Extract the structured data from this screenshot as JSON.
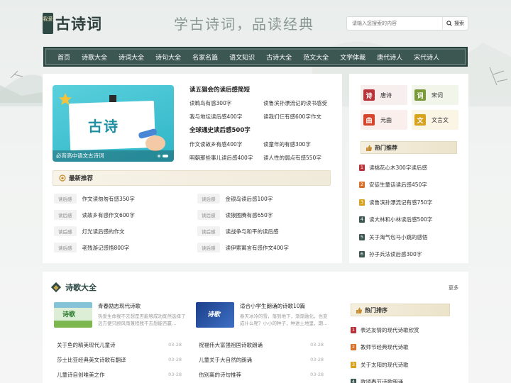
{
  "header": {
    "logo_seal": "我爱",
    "logo_text": "古诗词",
    "slogan": "学古诗词，品读经典",
    "search": {
      "placeholder": "请输入您搜索的内容",
      "button_label": "搜索"
    }
  },
  "nav": {
    "items": [
      "首页",
      "诗歌大全",
      "诗词大全",
      "诗句大全",
      "名家名篇",
      "语文知识",
      "古诗大全",
      "范文大全",
      "文学体裁",
      "唐代诗人",
      "宋代诗人"
    ]
  },
  "banner": {
    "title": "古诗",
    "caption": "必背高中语文古诗词"
  },
  "notes": {
    "heading1": "读五猖会的读后感简短",
    "list1": [
      "读鹈鸟有感300字",
      "读鲁滨孙漂流记的读书感受",
      "我与地坛读后感400字",
      "读我们仨有感600字作文"
    ],
    "heading2": "全球通史读后感500字",
    "list2": [
      "作文读故乡有感400字",
      "读童年的有感300字",
      "明朝那些事儿读后感400字",
      "读人性的弱点有感550字"
    ]
  },
  "recommend": {
    "title": "最新推荐",
    "items": [
      {
        "tag": "读后感",
        "text": "作文读匆匆有感350字"
      },
      {
        "tag": "读后感",
        "text": "金银岛读后感100字"
      },
      {
        "tag": "读后感",
        "text": "读故乡有感作文600字"
      },
      {
        "tag": "读后感",
        "text": "读狼图腾有感650字"
      },
      {
        "tag": "读后感",
        "text": "灯光读后感的作文"
      },
      {
        "tag": "读后感",
        "text": "读战争与和平的读后感"
      },
      {
        "tag": "读后感",
        "text": "老残游记感悟800字"
      },
      {
        "tag": "读后感",
        "text": "读伊索寓言有感作文400字"
      }
    ]
  },
  "categories": [
    {
      "icon": "诗",
      "label": "唐诗",
      "color": "#b8343a",
      "bg": "#f7eeee"
    },
    {
      "icon": "词",
      "label": "宋词",
      "color": "#7a9a3a",
      "bg": "#f1f5ea"
    },
    {
      "icon": "曲",
      "label": "元曲",
      "color": "#d4452b",
      "bg": "#faefec"
    },
    {
      "icon": "文",
      "label": "文言文",
      "color": "#d8a21f",
      "bg": "#fbf5e6"
    }
  ],
  "hot_recommend": {
    "title": "热门推荐",
    "items": [
      "读桃花心木300字读后感",
      "安徒生童话读后感450字",
      "读鲁滨孙漂流记有感750字",
      "读大林和小林读后感500字",
      "关于淘气包马小跳的感悟",
      "孙子兵法读后感300字"
    ]
  },
  "poetry": {
    "title": "诗歌大全",
    "more": "更多",
    "cards": [
      {
        "title": "青春励志现代诗歌",
        "desc": "热爱生命我不去想是否能够成功既然选择了远方便只顾风雨兼程我不去想能否赢…",
        "thumb_text": "诗歌"
      },
      {
        "title": "适合小学生朗诵的诗歌10篇",
        "desc": "春天冰冷的雪，落到地下，渐渐融化，也变成什么呢？小小的种子，种进土地里，期…",
        "thumb_text": "诗歌"
      }
    ],
    "col1": [
      {
        "text": "关于鱼的精美现代儿童诗",
        "date": "03-28"
      },
      {
        "text": "莎士比亚经典英文诗歌有翻译",
        "date": "03-28"
      },
      {
        "text": "儿童诗自创唯美之作",
        "date": "03-28"
      }
    ],
    "col2": [
      {
        "text": "祝福伟大富强祖国诗歌朗诵",
        "date": "03-28"
      },
      {
        "text": "儿童关于大自然的朗诵",
        "date": "03-28"
      },
      {
        "text": "伤别离的诗句推荐",
        "date": "03-28"
      }
    ],
    "hot_title": "热门排序",
    "hot_items": [
      "表达友情的现代诗歌欣赏",
      "教师节经典现代诗歌",
      "关于太阳的现代诗歌",
      "歌颂春节诗歌朗诵"
    ]
  },
  "colors": {
    "nav_bg": "#3c5752",
    "rank_top": "#b8343a",
    "rank_2": "#d8702a",
    "rank_3": "#d8a21f",
    "rank_rest": "#3c5752"
  }
}
